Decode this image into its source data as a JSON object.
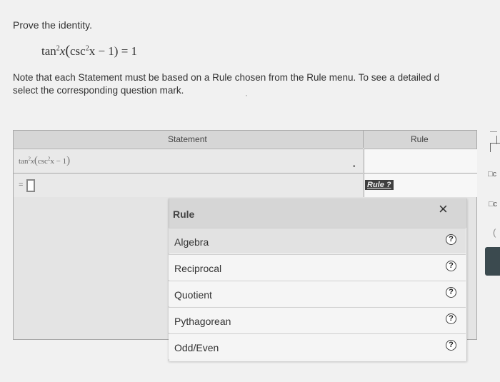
{
  "prompt": "Prove the identity.",
  "identity": {
    "tan": "tan",
    "exp1": "2",
    "x1": "x",
    "csc": "csc",
    "exp2": "2",
    "rest": "x − 1) = 1"
  },
  "note": {
    "line1": "Note that each Statement must be based on a Rule chosen from the Rule menu. To see a detailed d",
    "line2": "select the corresponding question mark."
  },
  "table": {
    "statement_header": "Statement",
    "rule_header": "Rule",
    "row1": {
      "tan": "tan",
      "exp1": "2",
      "x": "x",
      "csc": "csc",
      "exp2": "2",
      "rest": "x − 1"
    },
    "row2": {
      "equals": "="
    },
    "rule_button": "Rule ?"
  },
  "menu": {
    "title": "Rule",
    "close": "×",
    "help": "?",
    "items": [
      "Algebra",
      "Reciprocal",
      "Quotient",
      "Pythagorean",
      "Odd/Even"
    ]
  },
  "right_edge": {
    "box1": "□c",
    "box2": "□c",
    "paren": "("
  }
}
